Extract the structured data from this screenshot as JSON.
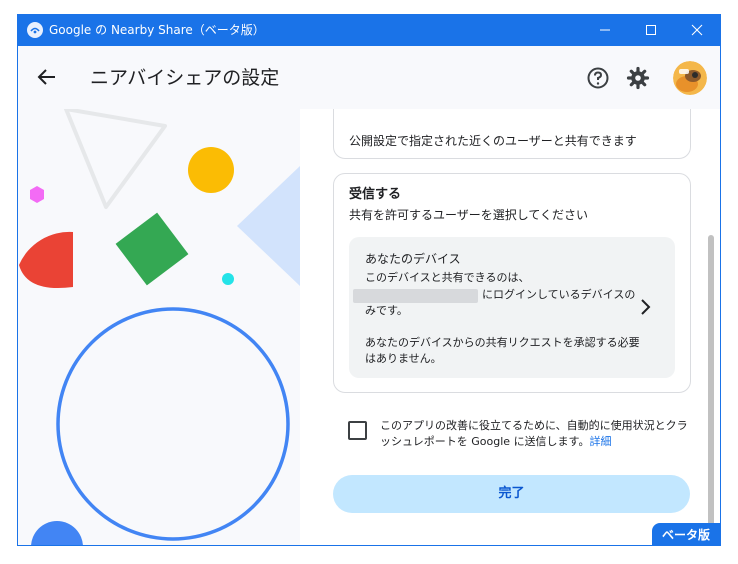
{
  "window": {
    "title": "Google の Nearby Share（ベータ版）",
    "accent": "#1a73e8"
  },
  "header": {
    "title": "ニアバイシェアの設定",
    "icons": [
      "back-arrow-icon",
      "help-icon",
      "gear-icon",
      "avatar"
    ]
  },
  "visibility_card": {
    "text": "公開設定で指定された近くのユーザーと共有できます"
  },
  "receive_card": {
    "title": "受信する",
    "subtitle": "共有を許可するユーザーを選択してください",
    "device": {
      "title": "あなたのデバイス",
      "line1": "このデバイスと共有できるのは、",
      "line2_suffix": "にログインしているデバイスの",
      "line3": "みです。",
      "line4": "あなたのデバイスからの共有リクエストを承認する必要",
      "line5": "はありません。"
    }
  },
  "consent": {
    "text": "このアプリの改善に役立てるために、自動的に使用状況とクラッシュレポートを Google に送信します。",
    "link": "詳細",
    "checked": false
  },
  "done_button": "完了",
  "beta_badge": "ベータ版"
}
